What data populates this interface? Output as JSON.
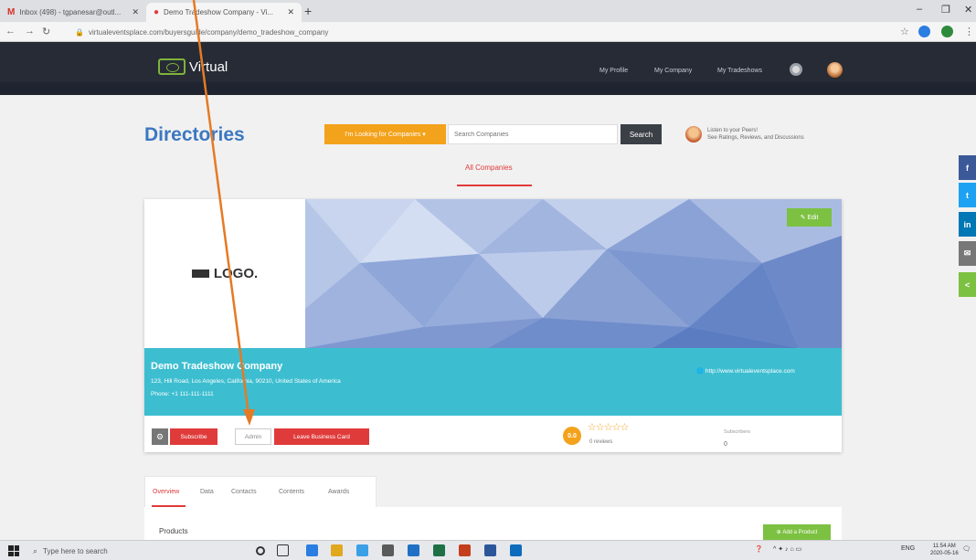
{
  "browser": {
    "tabs": [
      {
        "label": "Inbox (498) - tgpanesar@outl...",
        "icon": "gmail-icon"
      },
      {
        "label": "Demo Tradeshow Company - Vi...",
        "icon": "chrome-site-icon"
      }
    ],
    "new_tab": "+",
    "url": "virtualeventsplace.com/buyersguide/company/demo_tradeshow_company"
  },
  "site": {
    "brand": "Virtual",
    "nav": [
      "My Profile",
      "My Company",
      "My Tradeshows"
    ]
  },
  "directory": {
    "title": "Directories",
    "filter_label": "I'm Looking for Companies ▾",
    "search_placeholder": "Search Companies",
    "search_button": "Search",
    "listen_line1": "Listen to your Peers!",
    "listen_line2": "See Ratings, Reviews, and Discussions",
    "all_tab": "All Companies"
  },
  "social": [
    "f",
    "t",
    "in",
    "✉",
    "<"
  ],
  "company": {
    "logo_text": "LOGO.",
    "edit_label": "Edit",
    "name": "Demo Tradeshow Company",
    "address": "123, Hill Road, Los Angeles, California, 90210, United States of America",
    "phone": "Phone: +1 111-111-1111",
    "website": "http://www.virtualeventsplace.com",
    "subscribe_label": "Subscribe",
    "admin_label": "Admin",
    "card_label": "Leave Business Card",
    "rating": "0.0",
    "stars": "☆☆☆☆☆",
    "reviews": "0 reviews",
    "subscribers_label": "Subscribers",
    "subscribers_value": "0"
  },
  "profile_tabs": [
    "Overview",
    "Data",
    "Contacts",
    "Contents",
    "Awards"
  ],
  "products": {
    "label": "Products",
    "add_label": "Add a Product"
  },
  "taskbar": {
    "search_placeholder": "Type here to search",
    "lang": "ENG",
    "time": "11:54 AM",
    "date": "2020-05-16"
  },
  "colors": {
    "accent_red": "#e03b3b",
    "accent_orange": "#f3a21c",
    "teal": "#3dbed0",
    "green": "#7cc142",
    "blue_title": "#3b78c1",
    "nav_dark": "#262b35",
    "annotation_arrow": "#e57a25"
  }
}
